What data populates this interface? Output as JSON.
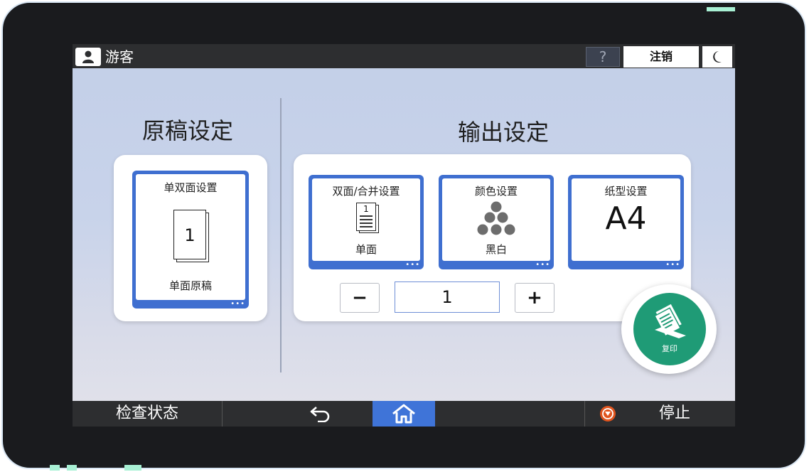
{
  "header": {
    "user_label": "游客",
    "help_label": "?",
    "logout_label": "注销"
  },
  "original": {
    "title": "原稿设定",
    "tile": {
      "title": "单双面设置",
      "page_number": "1",
      "sub": "单面原稿"
    }
  },
  "output": {
    "title": "输出设定",
    "tiles": [
      {
        "title": "双面/合并设置",
        "page_number": "1",
        "sub": "单面"
      },
      {
        "title": "颜色设置",
        "sub": "黑白"
      },
      {
        "title": "纸型设置",
        "value": "A4"
      }
    ]
  },
  "quantity": {
    "minus_label": "−",
    "value": "1",
    "plus_label": "+"
  },
  "copy_button": {
    "label": "复印",
    "color": "#1f9b76"
  },
  "bottom": {
    "status_label": "检查状态",
    "stop_label": "停止"
  },
  "accent_color": "#3f6fd0"
}
